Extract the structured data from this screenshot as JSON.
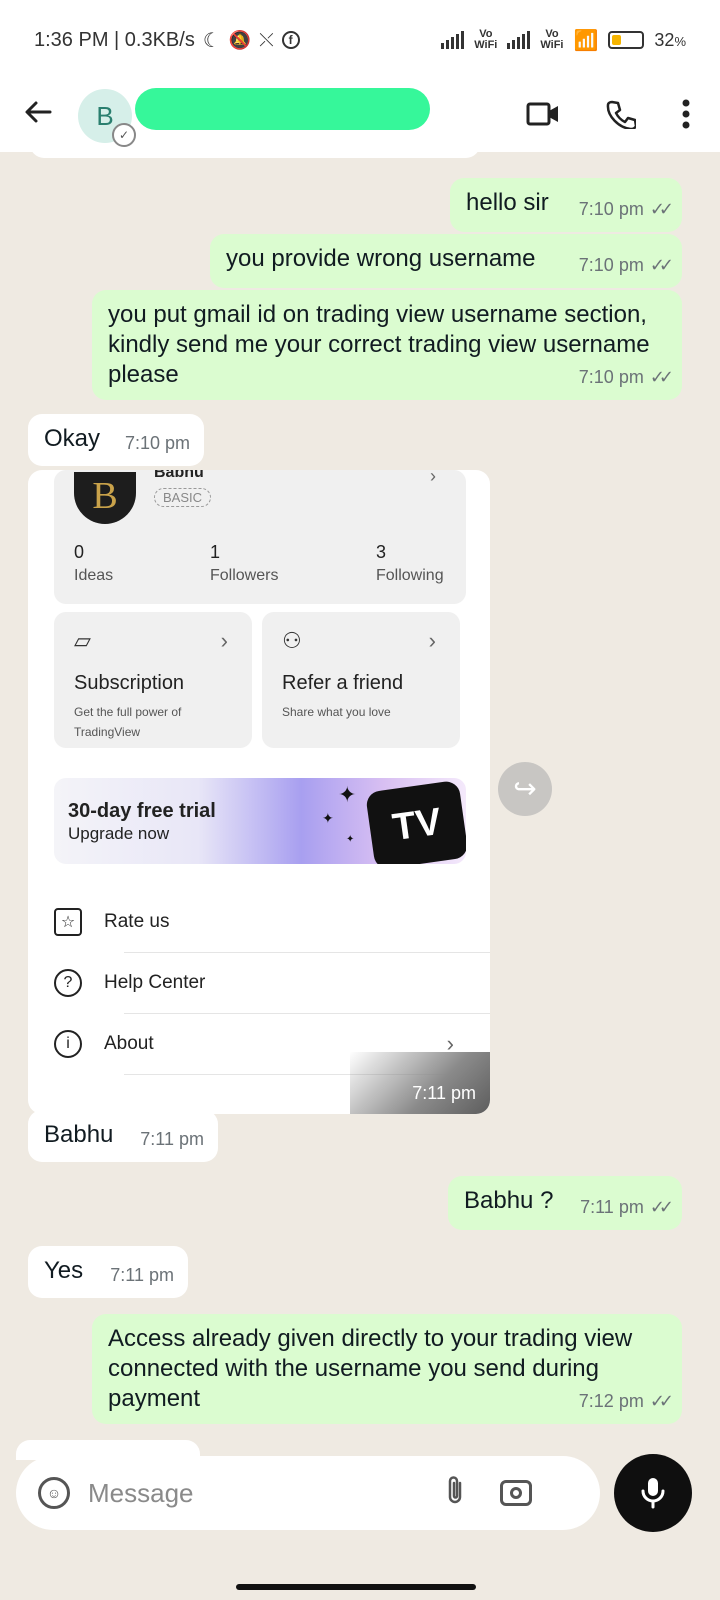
{
  "status": {
    "time_net": "1:36 PM | 0.3KB/s",
    "vo_wifi": "Vo\nWiFi",
    "battery": "32",
    "battery_unit": "%",
    "battery_level": 0.32
  },
  "header": {
    "avatar_letter": "B"
  },
  "messages": [
    {
      "dir": "out",
      "text": "hello sir",
      "time": "7:10 pm"
    },
    {
      "dir": "out",
      "text": "you provide wrong username",
      "time": "7:10 pm"
    },
    {
      "dir": "out",
      "text": "you put gmail id on trading view username section, kindly send me your correct trading view username please",
      "time": "7:10 pm"
    },
    {
      "dir": "in",
      "text": "Okay",
      "time": "7:10 pm"
    },
    {
      "dir": "in",
      "text": "Babhu",
      "time": "7:11 pm"
    },
    {
      "dir": "out",
      "text": "Babhu ?",
      "time": "7:11 pm"
    },
    {
      "dir": "in",
      "text": "Yes",
      "time": "7:11 pm"
    },
    {
      "dir": "out",
      "text": "Access already given directly to your trading view connected with the username you send during payment",
      "time": "7:12 pm"
    }
  ],
  "card": {
    "profile_name": "Babhu",
    "plan_badge": "BASIC",
    "stats": [
      {
        "value": "0",
        "label": "Ideas"
      },
      {
        "value": "1",
        "label": "Followers"
      },
      {
        "value": "3",
        "label": "Following"
      }
    ],
    "tiles": [
      {
        "title": "Subscription",
        "subtitle": "Get the full power of TradingView"
      },
      {
        "title": "Refer a friend",
        "subtitle": "Share what you love"
      }
    ],
    "trial_title": "30-day free trial",
    "trial_subtitle": "Upgrade now",
    "trial_logo": "TV",
    "menu": [
      "Rate us",
      "Help Center",
      "About"
    ],
    "time": "7:11 pm"
  },
  "input": {
    "placeholder": "Message"
  }
}
